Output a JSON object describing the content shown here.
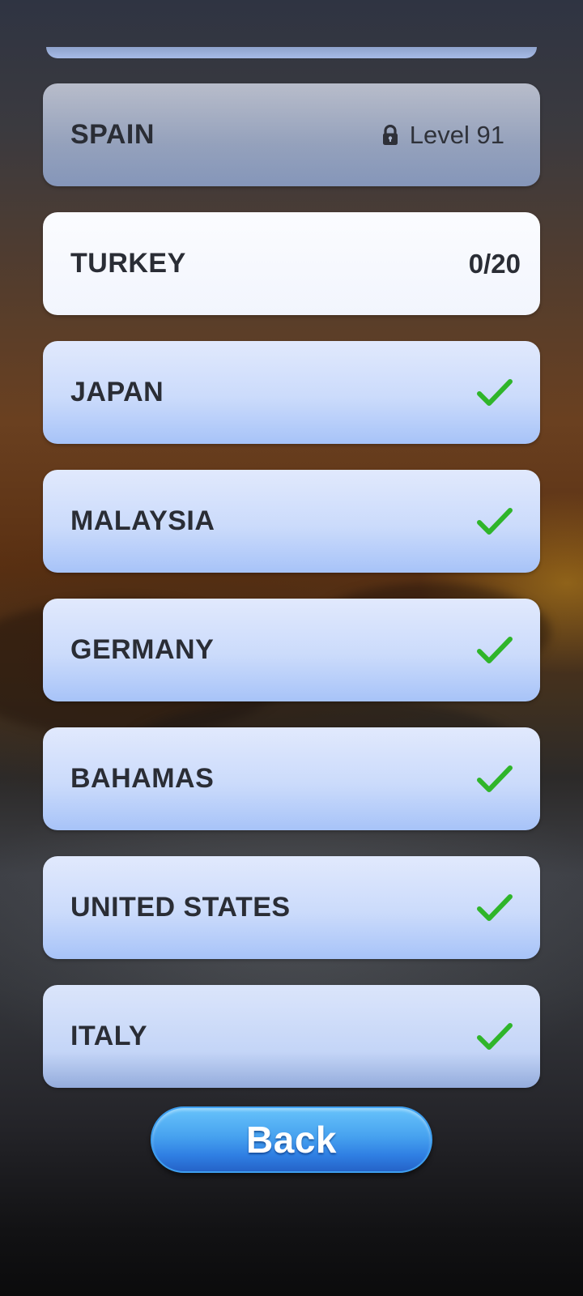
{
  "countries": [
    {
      "name": "SPAIN",
      "state": "locked",
      "lock_icon": "lock-icon",
      "level_label": "Level 91"
    },
    {
      "name": "TURKEY",
      "state": "current",
      "progress": "0/20"
    },
    {
      "name": "JAPAN",
      "state": "completed",
      "status_icon": "checkmark-icon"
    },
    {
      "name": "MALAYSIA",
      "state": "completed",
      "status_icon": "checkmark-icon"
    },
    {
      "name": "GERMANY",
      "state": "completed",
      "status_icon": "checkmark-icon"
    },
    {
      "name": "BAHAMAS",
      "state": "completed",
      "status_icon": "checkmark-icon"
    },
    {
      "name": "UNITED STATES",
      "state": "completed",
      "status_icon": "checkmark-icon"
    },
    {
      "name": "ITALY",
      "state": "completed",
      "status_icon": "checkmark-icon"
    }
  ],
  "back_button": {
    "label": "Back"
  },
  "colors": {
    "check_green": "#2fb52a",
    "text_dark": "#2a2d35",
    "button_blue": "#3a8ff0",
    "card_blue": "#cbdbfb"
  }
}
